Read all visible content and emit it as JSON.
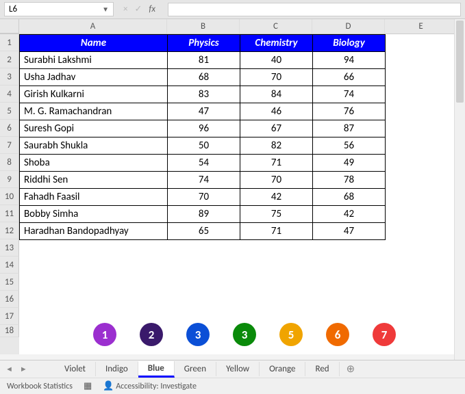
{
  "namebox": {
    "value": "L6"
  },
  "formula_bar": {
    "cancel_icon": "×",
    "enter_icon": "✓",
    "fx_label": "fx",
    "value": ""
  },
  "columns": [
    "A",
    "B",
    "C",
    "D",
    "E"
  ],
  "rows": [
    "1",
    "2",
    "3",
    "4",
    "5",
    "6",
    "7",
    "8",
    "9",
    "10",
    "11",
    "12",
    "13",
    "14",
    "15",
    "16",
    "17",
    "18"
  ],
  "table": {
    "headers": [
      "Name",
      "Physics",
      "Chemistry",
      "Biology"
    ],
    "data": [
      [
        "Surabhi Lakshmi",
        81,
        40,
        94
      ],
      [
        "Usha Jadhav",
        68,
        70,
        66
      ],
      [
        "Girish Kulkarni",
        83,
        84,
        74
      ],
      [
        "M. G. Ramachandran",
        47,
        46,
        76
      ],
      [
        "Suresh Gopi",
        96,
        67,
        87
      ],
      [
        "Saurabh Shukla",
        50,
        82,
        56
      ],
      [
        "Shoba",
        54,
        71,
        49
      ],
      [
        "Riddhi Sen",
        74,
        70,
        78
      ],
      [
        "Fahadh Faasil",
        70,
        42,
        68
      ],
      [
        "Bobby Simha",
        89,
        75,
        42
      ],
      [
        "Haradhan Bandopadhyay",
        65,
        71,
        47
      ]
    ]
  },
  "badges": [
    {
      "label": "1",
      "color": "#9b2fcf"
    },
    {
      "label": "2",
      "color": "#3a1a6b"
    },
    {
      "label": "3",
      "color": "#0b4fd6"
    },
    {
      "label": "3",
      "color": "#0a8a0a"
    },
    {
      "label": "5",
      "color": "#f0a400"
    },
    {
      "label": "6",
      "color": "#f06a00"
    },
    {
      "label": "7",
      "color": "#ef3a3a"
    }
  ],
  "tabs": {
    "items": [
      "Violet",
      "Indigo",
      "Blue",
      "Green",
      "Yellow",
      "Orange",
      "Red"
    ],
    "active": "Blue",
    "add_icon": "⊕"
  },
  "status": {
    "stats_label": "Workbook Statistics",
    "grid_icon": "▦",
    "a11y_icon": "👤",
    "a11y_label": "Accessibility: Investigate"
  },
  "sheet_nav": {
    "prev": "◄",
    "next": "►"
  }
}
